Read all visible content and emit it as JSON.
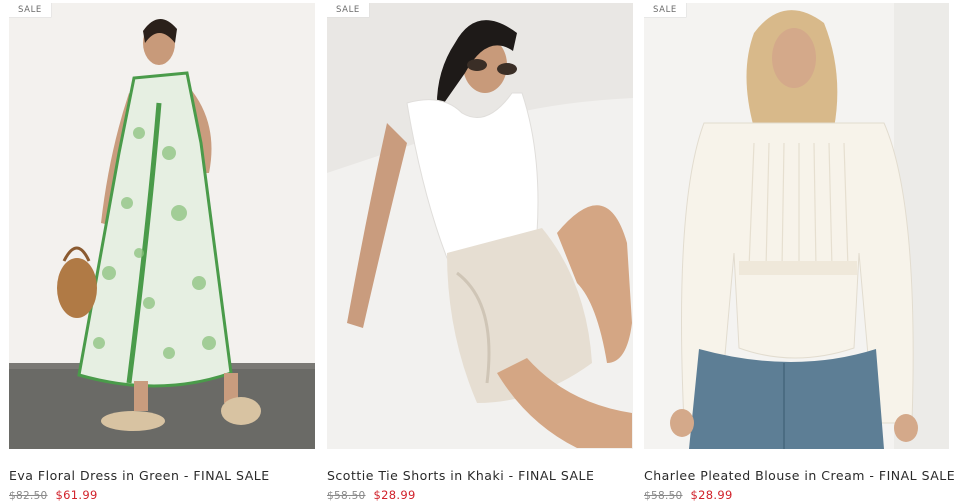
{
  "products": [
    {
      "badge": "SALE",
      "title": "Eva Floral Dress in Green - FINAL SALE",
      "original_price": "$82.50",
      "sale_price": "$61.99",
      "image_alt": "model in green floral dress"
    },
    {
      "badge": "SALE",
      "title": "Scottie Tie Shorts in Khaki - FINAL SALE",
      "original_price": "$58.50",
      "sale_price": "$28.99",
      "image_alt": "model in khaki tie shorts"
    },
    {
      "badge": "SALE",
      "title": "Charlee Pleated Blouse in Cream - FINAL SALE",
      "original_price": "$58.50",
      "sale_price": "$28.99",
      "image_alt": "model in cream pleated blouse"
    }
  ],
  "colors": {
    "sale_price": "#d1212a",
    "original_price": "#8a8a8a",
    "title": "#2a2a2a"
  }
}
